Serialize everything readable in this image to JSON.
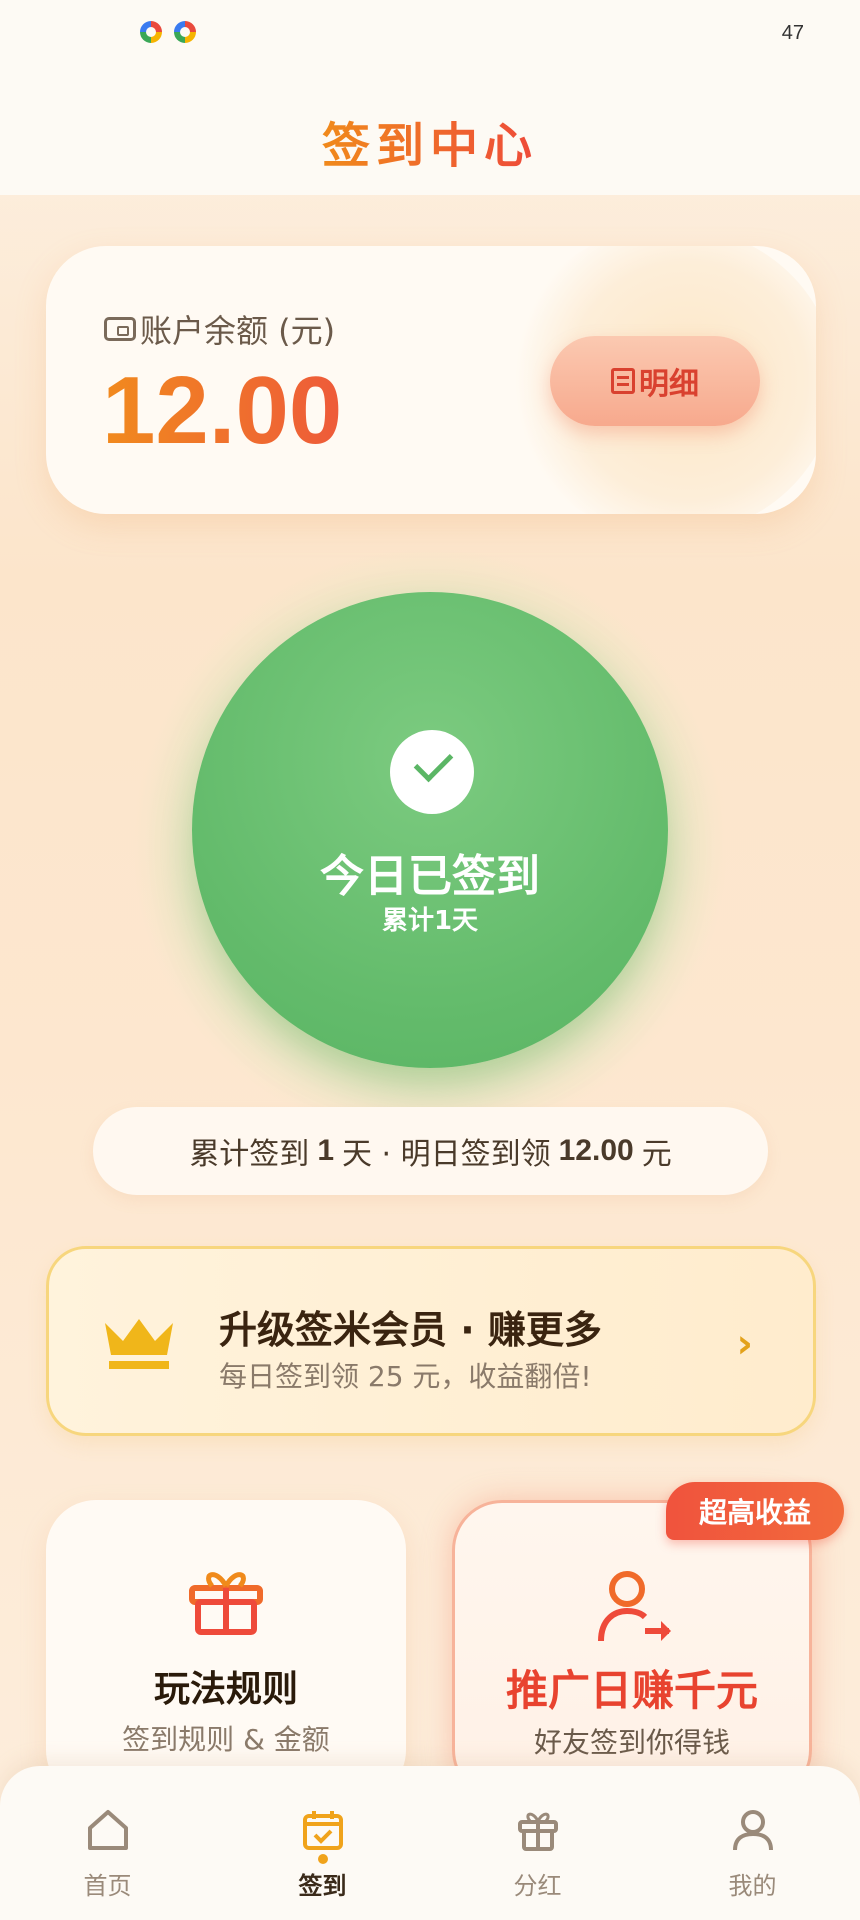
{
  "status_bar": {
    "time": "47"
  },
  "header": {
    "title": "签到中心"
  },
  "balance": {
    "label": "账户余额 (元)",
    "amount": "12.00",
    "detail_button": "明细"
  },
  "sign": {
    "status": "今日已签到",
    "cumulative": "累计1天"
  },
  "summary": {
    "prefix": "累计签到",
    "days": "1",
    "middle": "天 · 明日签到领",
    "reward": "12.00",
    "suffix": "元"
  },
  "vip": {
    "title": "升级签米会员 · 赚更多",
    "subtitle": "每日签到领 25 元，收益翻倍!",
    "arrow": "›"
  },
  "cards": {
    "rules": {
      "title": "玩法规则",
      "subtitle": "签到规则 & 金额"
    },
    "promo": {
      "title": "推广日赚千元",
      "subtitle": "好友签到你得钱",
      "badge": "超高收益"
    }
  },
  "nav": {
    "items": [
      {
        "label": "首页",
        "icon": "home-icon"
      },
      {
        "label": "签到",
        "icon": "calendar-check-icon",
        "active": true
      },
      {
        "label": "分红",
        "icon": "gift-icon"
      },
      {
        "label": "我的",
        "icon": "user-icon"
      }
    ]
  },
  "colors": {
    "accent_orange": "#f08a1b",
    "accent_red": "#e8432f",
    "success_green": "#63bb6b",
    "gold": "#e3a21b"
  }
}
